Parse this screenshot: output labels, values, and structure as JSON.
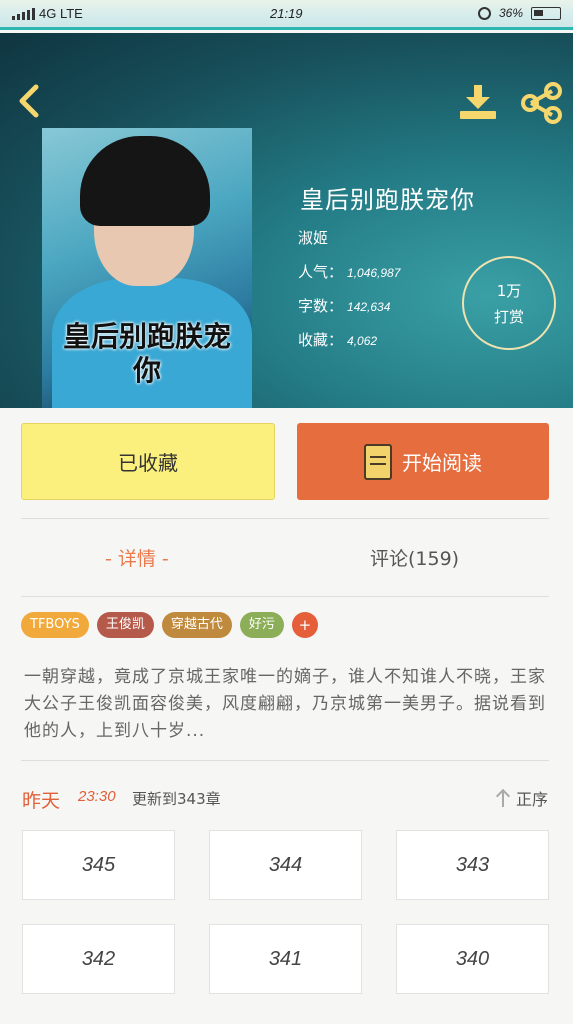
{
  "status_bar": {
    "network": "4G LTE",
    "time": "21:19",
    "battery": "36%"
  },
  "header": {
    "back_icon": "chevron-left-icon",
    "download_icon": "download-icon",
    "share_icon": "share-icon",
    "icon_color": "#f5d76e"
  },
  "book": {
    "cover_title": "皇后别跑朕宠你",
    "title": "皇后别跑朕宠你",
    "author": "淑姬",
    "popularity_label": "人气：",
    "popularity": "1,046,987",
    "words_label": "字数：",
    "words": "142,634",
    "favorites_label": "收藏：",
    "favorites": "4,062",
    "tip_line1": "1万",
    "tip_line2": "打赏"
  },
  "actions": {
    "favorited_label": "已收藏",
    "read_label": "开始阅读"
  },
  "tabs": {
    "detail": "- 详情 -",
    "comments": "评论(159)"
  },
  "tags": [
    {
      "label": "TFBOYS",
      "color": "#f2a93b"
    },
    {
      "label": "王俊凯",
      "color": "#b55a4a"
    },
    {
      "label": "穿越古代",
      "color": "#c08a3e"
    },
    {
      "label": "好污",
      "color": "#8cae58"
    }
  ],
  "add_tag": "+",
  "synopsis": "一朝穿越，竟成了京城王家唯一的嫡子，谁人不知谁人不晓，王家大公子王俊凯面容俊美，风度翩翩，乃京城第一美男子。据说看到他的人，上到八十岁...",
  "update": {
    "day": "昨天",
    "time": "23:30",
    "text": "更新到343章",
    "sort_label": "正序"
  },
  "chapters": [
    "345",
    "344",
    "343",
    "342",
    "341",
    "340"
  ]
}
